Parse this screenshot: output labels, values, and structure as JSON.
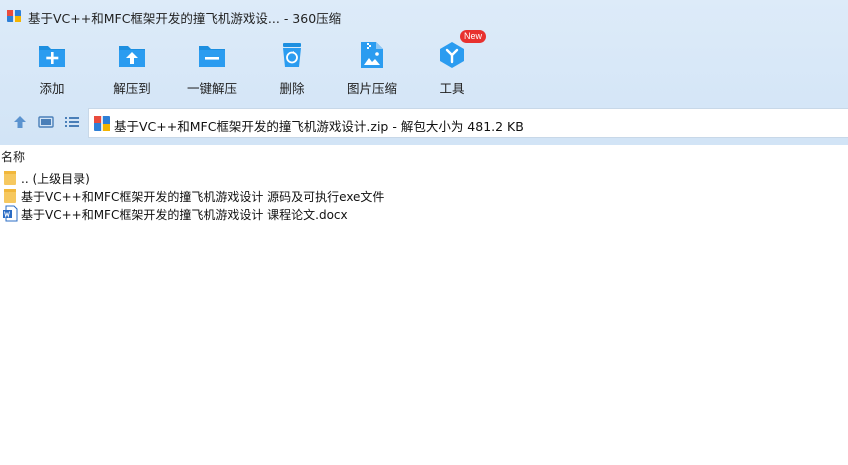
{
  "window": {
    "title": "基于VC++和MFC框架开发的撞飞机游戏设... - 360压缩"
  },
  "toolbar": {
    "items": [
      {
        "label": "添加",
        "icon": "add-icon"
      },
      {
        "label": "解压到",
        "icon": "extract-to-icon"
      },
      {
        "label": "一键解压",
        "icon": "one-click-extract-icon"
      },
      {
        "label": "删除",
        "icon": "delete-icon"
      },
      {
        "label": "图片压缩",
        "icon": "image-compress-icon"
      },
      {
        "label": "工具",
        "icon": "tools-icon",
        "badge": "New"
      }
    ]
  },
  "address": {
    "text": "基于VC++和MFC框架开发的撞飞机游戏设计.zip - 解包大小为 481.2 KB"
  },
  "filelist": {
    "column_name": "名称",
    "rows": [
      {
        "name": ".. (上级目录)",
        "icon": "folder-icon"
      },
      {
        "name": "基于VC++和MFC框架开发的撞飞机游戏设计 源码及可执行exe文件",
        "icon": "folder-icon"
      },
      {
        "name": "基于VC++和MFC框架开发的撞飞机游戏设计 课程论文.docx",
        "icon": "word-doc-icon"
      }
    ]
  },
  "colors": {
    "accent": "#1d8fe0",
    "toolbar_bg": "#d6e7f8",
    "folder": "#f6c85f",
    "badge": "#e8312f"
  }
}
